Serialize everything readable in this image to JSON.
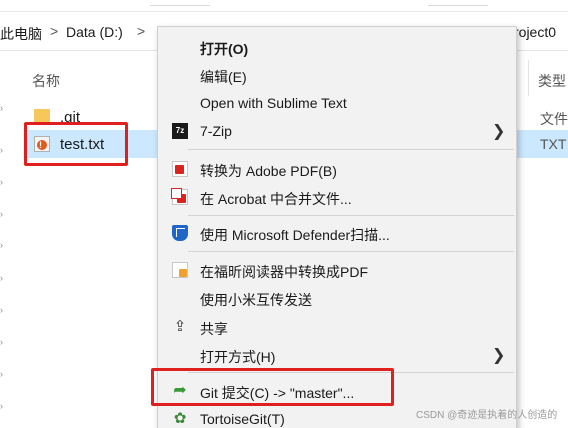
{
  "address": {
    "segments": [
      "此电脑",
      "Data (D:)",
      "roject0"
    ],
    "separator": ">"
  },
  "columns": {
    "name": "名称",
    "type": "类型"
  },
  "files": [
    {
      "name": ".git",
      "type": "文件",
      "icon": "folder-icon"
    },
    {
      "name": "test.txt",
      "type": "TXT",
      "icon": "txt-file-icon",
      "selected": true
    }
  ],
  "context_menu": {
    "items": [
      {
        "id": "open",
        "label": "打开(O)",
        "bold": true
      },
      {
        "id": "edit",
        "label": "编辑(E)"
      },
      {
        "id": "sublime",
        "label": "Open with Sublime Text"
      },
      {
        "id": "7zip",
        "label": "7-Zip",
        "icon": "7zip-icon",
        "submenu": true
      },
      {
        "id": "to-pdf",
        "label": "转换为 Adobe PDF(B)",
        "icon": "adobe-pdf-icon"
      },
      {
        "id": "acrobat-merge",
        "label": "在 Acrobat 中合并文件...",
        "icon": "acrobat-merge-icon"
      },
      {
        "id": "defender",
        "label": "使用 Microsoft Defender扫描...",
        "icon": "defender-shield-icon"
      },
      {
        "id": "foxit",
        "label": "在福昕阅读器中转换成PDF",
        "icon": "foxit-reader-icon"
      },
      {
        "id": "xiaomi",
        "label": "使用小米互传发送"
      },
      {
        "id": "share",
        "label": "共享",
        "icon": "share-icon"
      },
      {
        "id": "open-with",
        "label": "打开方式(H)",
        "submenu": true
      },
      {
        "id": "git-commit",
        "label": "Git 提交(C) -> \"master\"...",
        "icon": "git-commit-icon"
      },
      {
        "id": "tortoise",
        "label": "TortoiseGit(T)",
        "icon": "tortoisegit-icon"
      }
    ]
  },
  "watermark": "CSDN @奇迹是执着的人创造的",
  "colors": {
    "selection": "#cce8ff",
    "highlight_box": "#e0201e",
    "menu_bg": "#f2f2f2"
  }
}
